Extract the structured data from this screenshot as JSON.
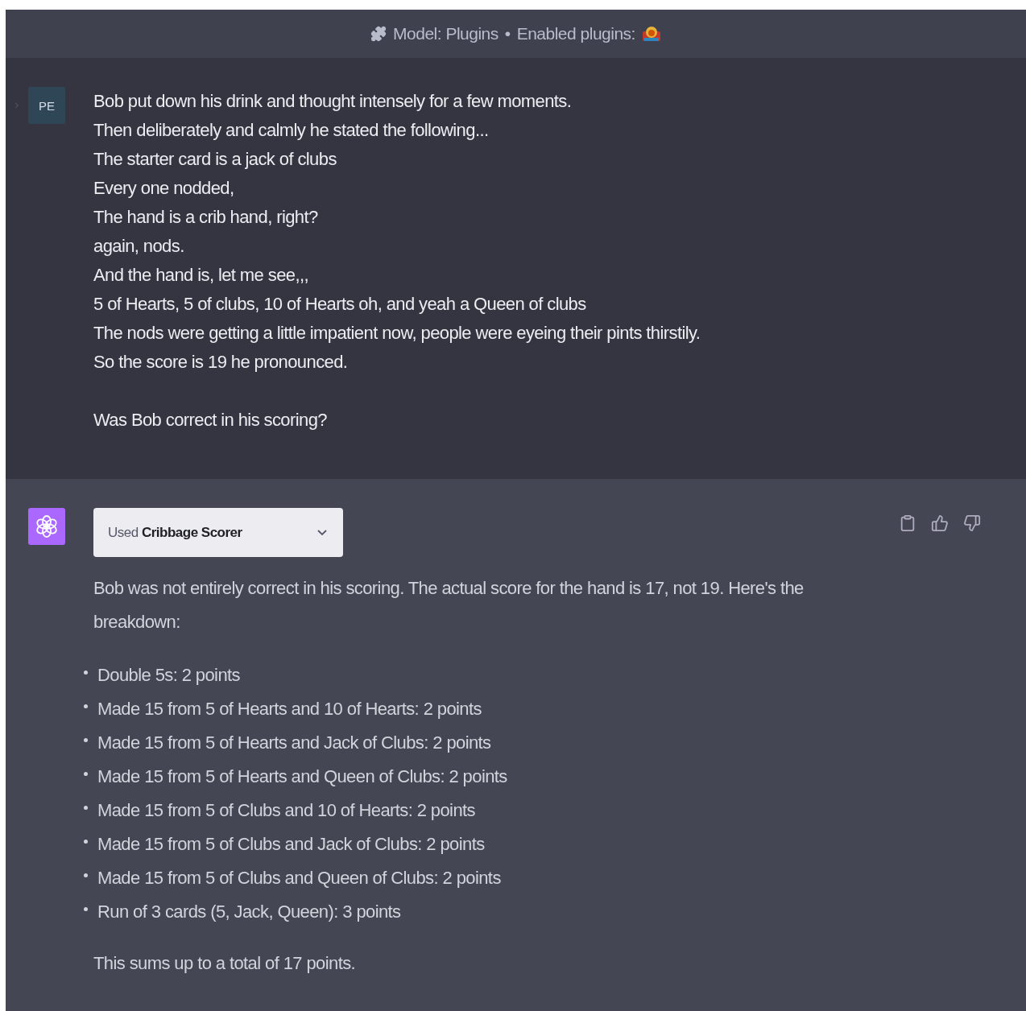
{
  "header": {
    "model": "Model: Plugins",
    "separator": "•",
    "enabled_label": "Enabled plugins:"
  },
  "user_message": {
    "avatar": "PE",
    "paragraphs": [
      [
        "Bob put down his drink and thought intensely for a few moments.",
        "Then deliberately and calmly he stated the following...",
        "The starter card is a jack of clubs",
        "Every one nodded,",
        "The hand is a crib hand, right?",
        "again, nods.",
        "And the hand is, let me see,,,",
        "5 of Hearts, 5 of clubs, 10 of Hearts oh, and yeah  a Queen of clubs",
        "The nods were getting a little impatient now, people were eyeing their pints thirstily.",
        "So the score is 19 he pronounced."
      ],
      [
        "Was Bob correct in his scoring?"
      ]
    ]
  },
  "assistant_message": {
    "plugin_pill": {
      "label": "Used **Cribbage Scorer**",
      "expanded": false
    },
    "intro": "Bob was not entirely correct in his scoring. The actual score for the hand is 17, not 19. Here's the breakdown:",
    "bullets": [
      "Double 5s: 2 points",
      "Made 15 from 5 of Hearts and 10 of Hearts: 2 points",
      "Made 15 from 5 of Hearts and Jack of Clubs: 2 points",
      "Made 15 from 5 of Hearts and Queen of Clubs: 2 points",
      "Made 15 from 5 of Clubs and 10 of Hearts: 2 points",
      "Made 15 from 5 of Clubs and Jack of Clubs: 2 points",
      "Made 15 from 5 of Clubs and Queen of Clubs: 2 points",
      "Run of 3 cards (5, Jack, Queen): 3 points"
    ],
    "summary": "This sums up to a total of 17 points."
  }
}
